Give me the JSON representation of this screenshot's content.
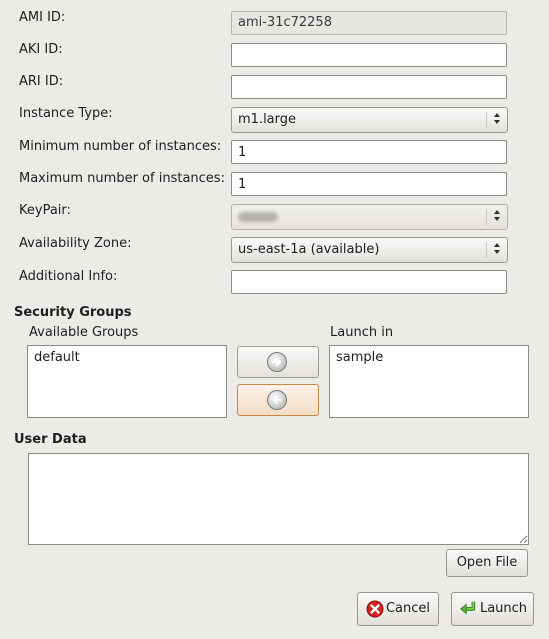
{
  "form": {
    "ami_label": "AMI ID:",
    "ami_value": "ami-31c72258",
    "aki_label": "AKI ID:",
    "aki_value": "",
    "ari_label": "ARI ID:",
    "ari_value": "",
    "instance_type_label": "Instance Type:",
    "instance_type_value": "m1.large",
    "min_label": "Minimum number of instances:",
    "min_value": "1",
    "max_label": "Maximum number of instances:",
    "max_value": "1",
    "keypair_label": "KeyPair:",
    "zone_label": "Availability Zone:",
    "zone_value": "us-east-1a (available)",
    "additional_label": "Additional Info:",
    "additional_value": ""
  },
  "security": {
    "title": "Security Groups",
    "available_label": "Available Groups",
    "available_items": [
      "default"
    ],
    "launch_label": "Launch in",
    "launch_items": [
      "sample"
    ]
  },
  "user_data": {
    "title": "User Data",
    "value": "",
    "open_file": "Open File"
  },
  "actions": {
    "cancel": "Cancel",
    "launch": "Launch"
  },
  "icons": {
    "add": "arrow-right-icon",
    "remove": "arrow-left-icon",
    "cancel": "cancel-icon",
    "launch": "enter-icon"
  }
}
